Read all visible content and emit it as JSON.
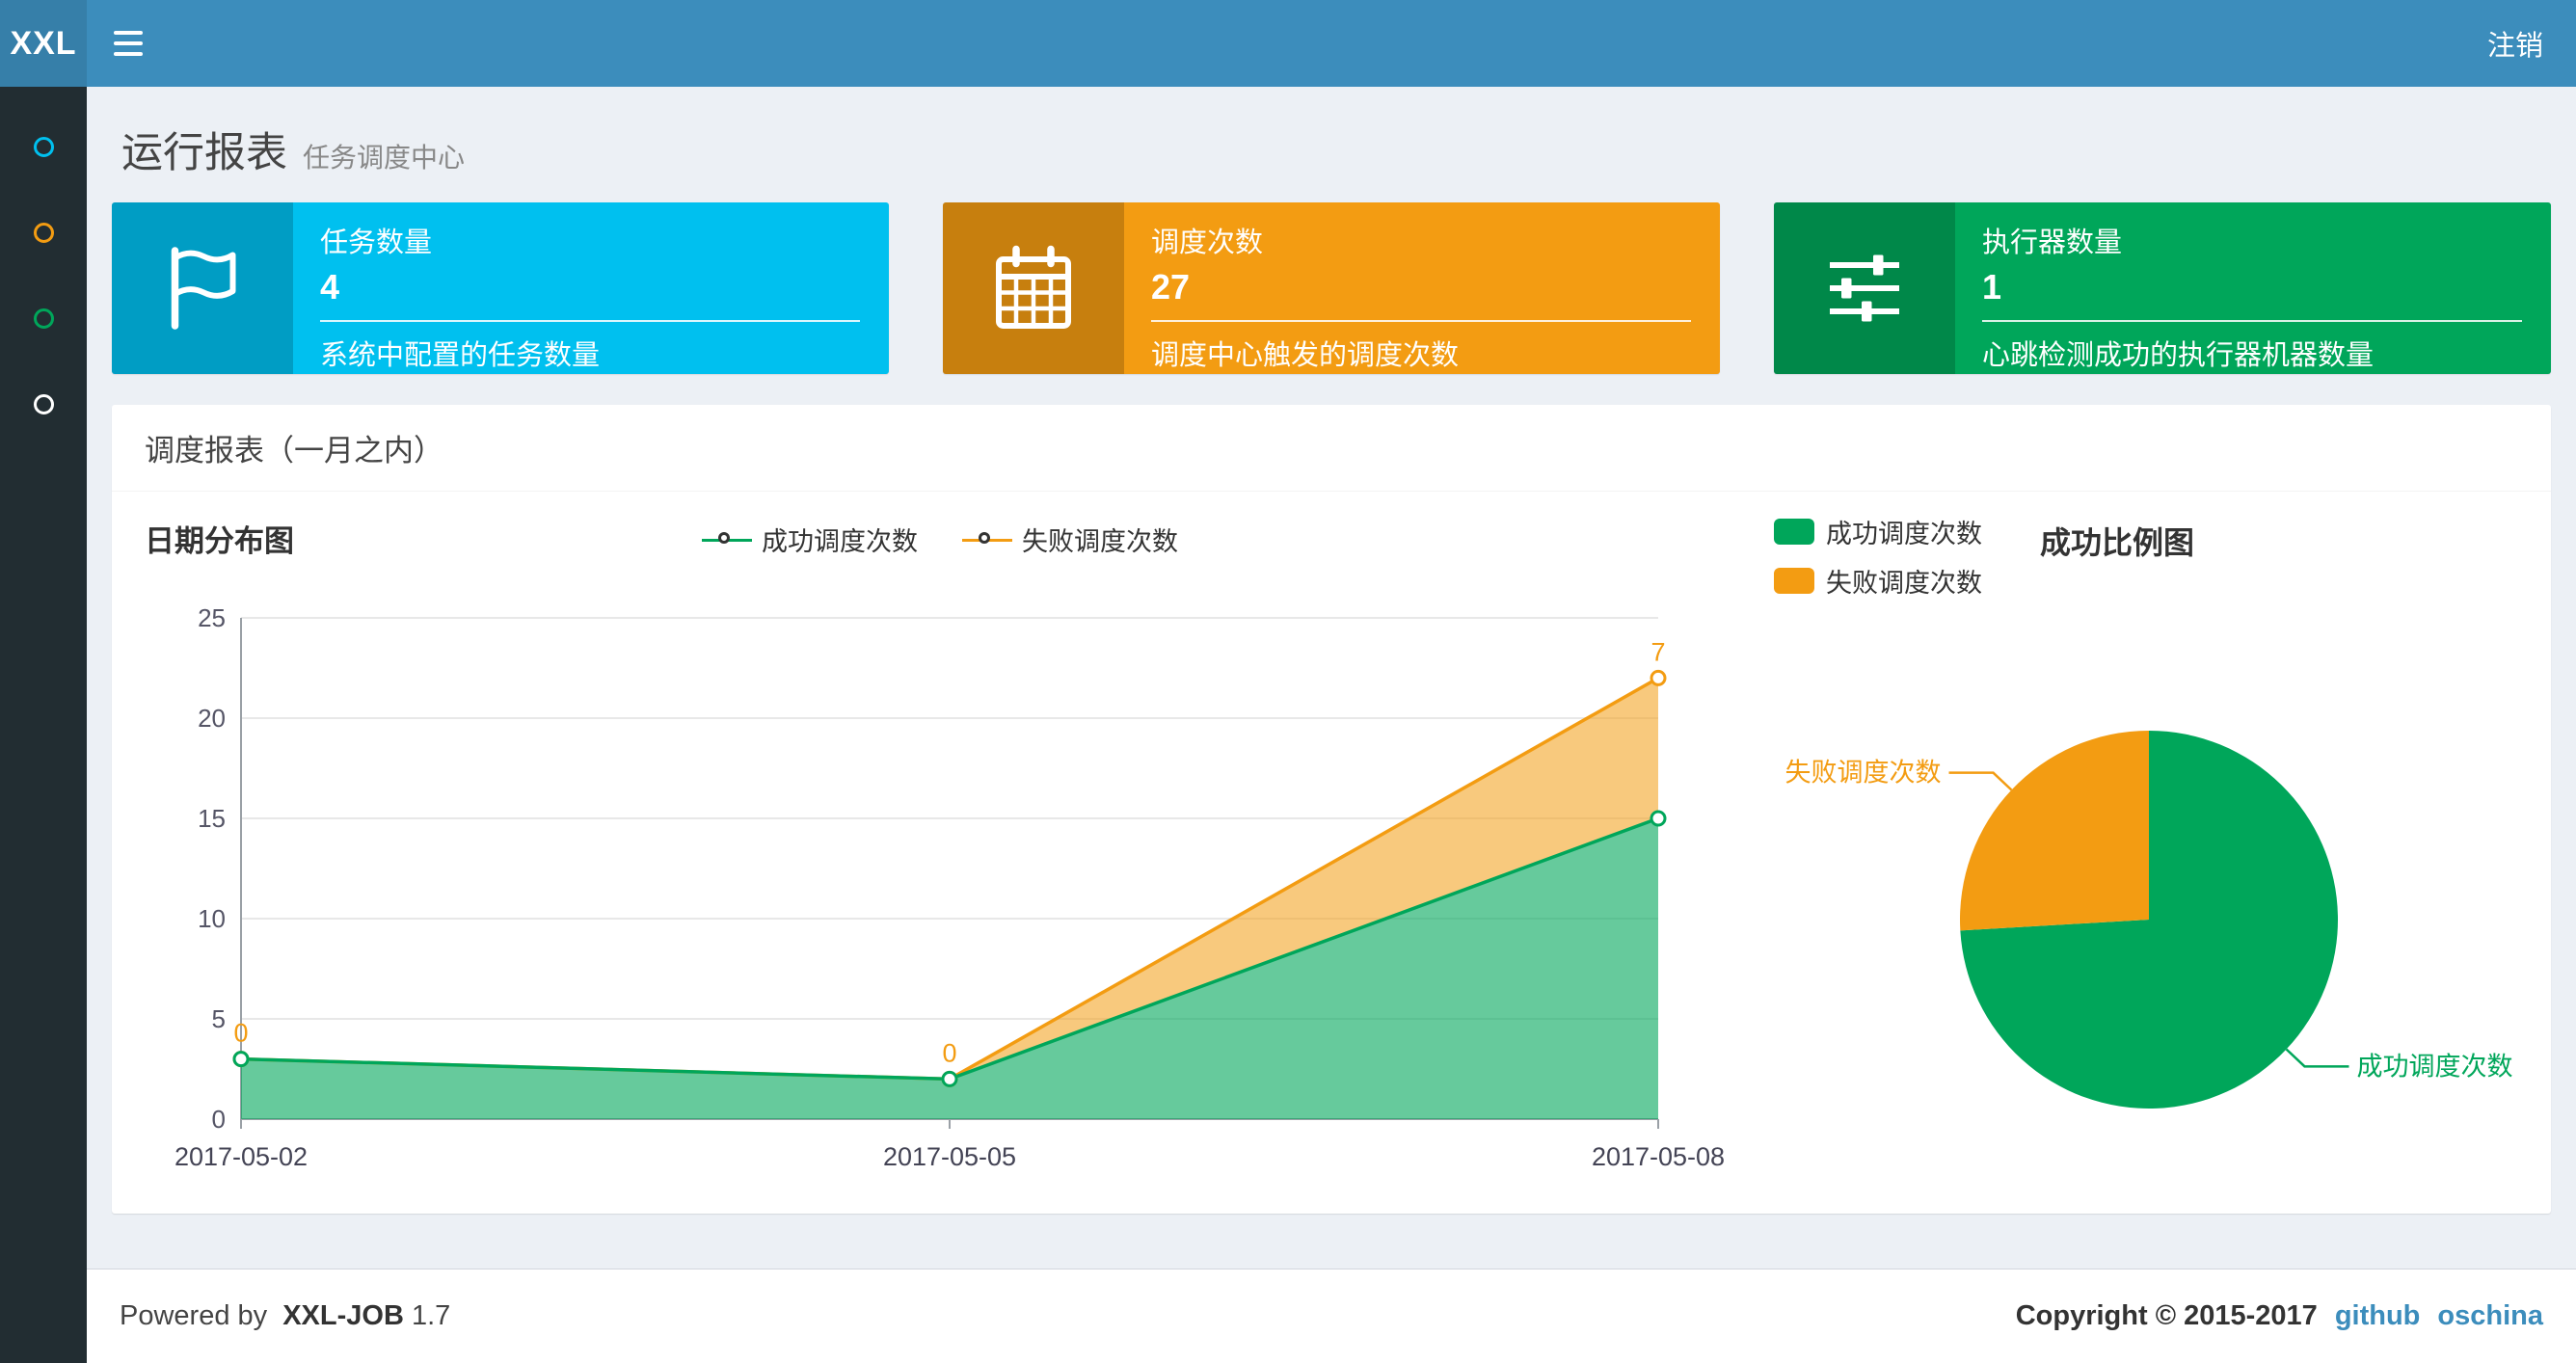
{
  "navbar": {
    "logo": "XXL",
    "logout_label": "注销"
  },
  "sidebar": {
    "items": [
      {
        "name": "menu-item-1",
        "icon": "circle-icon",
        "color": "#00c0ef"
      },
      {
        "name": "menu-item-2",
        "icon": "circle-icon",
        "color": "#f39c12"
      },
      {
        "name": "menu-item-3",
        "icon": "circle-icon",
        "color": "#00a65a"
      },
      {
        "name": "menu-item-4",
        "icon": "circle-icon",
        "color": "#ffffff"
      }
    ]
  },
  "page_header": {
    "title": "运行报表",
    "subtitle": "任务调度中心"
  },
  "info_boxes": [
    {
      "label": "任务数量",
      "value": "4",
      "desc": "系统中配置的任务数量",
      "color": "#00c0ef",
      "icon": "flag-icon"
    },
    {
      "label": "调度次数",
      "value": "27",
      "desc": "调度中心触发的调度次数",
      "color": "#f39c12",
      "icon": "calendar-icon"
    },
    {
      "label": "执行器数量",
      "value": "1",
      "desc": "心跳检测成功的执行器机器数量",
      "color": "#00a65a",
      "icon": "sliders-icon"
    }
  ],
  "panel": {
    "title": "调度报表（一月之内）"
  },
  "chart_data": [
    {
      "type": "area",
      "title": "日期分布图",
      "x": [
        "2017-05-02",
        "2017-05-05",
        "2017-05-08"
      ],
      "stacked": true,
      "series": [
        {
          "name": "成功调度次数",
          "values": [
            3,
            2,
            15
          ],
          "color": "#00a65a"
        },
        {
          "name": "失败调度次数",
          "values": [
            0,
            0,
            7
          ],
          "color": "#f39c12",
          "labels": [
            "0",
            "0",
            "7"
          ]
        }
      ],
      "ylim": [
        0,
        25
      ],
      "yticks": [
        0,
        5,
        10,
        15,
        20,
        25
      ],
      "grid": true,
      "legend_position": "top-center"
    },
    {
      "type": "pie",
      "title": "成功比例图",
      "slices": [
        {
          "name": "成功调度次数",
          "value": 20,
          "color": "#00a65a"
        },
        {
          "name": "失败调度次数",
          "value": 7,
          "color": "#f39c12"
        }
      ],
      "legend_position": "top-left"
    }
  ],
  "footer": {
    "powered_by": "Powered by",
    "brand": "XXL-JOB",
    "version": "1.7",
    "copyright": "Copyright © 2015-2017",
    "links": [
      {
        "label": "github"
      },
      {
        "label": "oschina"
      }
    ]
  }
}
